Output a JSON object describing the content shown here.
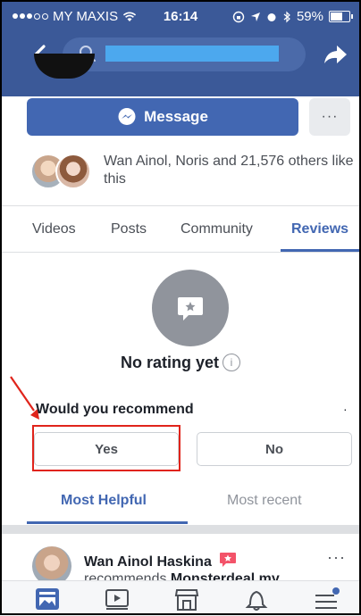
{
  "status_bar": {
    "carrier": "MY MAXIS",
    "time": "16:14",
    "battery": "59%"
  },
  "search": {
    "value": "",
    "placeholder": ""
  },
  "page": {
    "message_label": "Message",
    "more_label": "···",
    "likes_text": "Wan Ainol, Noris and 21,576 others like this"
  },
  "tabs": [
    {
      "label": "Videos"
    },
    {
      "label": "Posts"
    },
    {
      "label": "Community"
    },
    {
      "label": "Reviews"
    }
  ],
  "reviews": {
    "no_rating": "No rating yet",
    "info": "i",
    "question": "Would you recommend",
    "yes": "Yes",
    "no": "No",
    "sort_helpful": "Most Helpful",
    "sort_recent": "Most recent"
  },
  "post": {
    "author": "Wan Ainol Haskina",
    "verb": "recommends ",
    "target": "Monsterdeal.my",
    "more": "···"
  },
  "colors": {
    "brand": "#3b5998",
    "accent": "#4267b2",
    "highlight": "#e0241b"
  }
}
